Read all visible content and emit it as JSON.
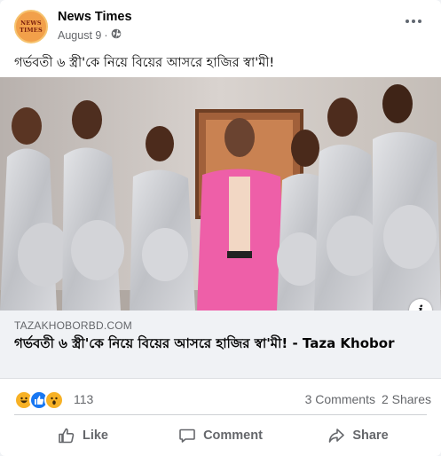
{
  "post": {
    "page_name": "News Times",
    "avatar_text": "NEWS TIMES",
    "date": "August 9",
    "separator": "·",
    "audience_icon": "globe-icon",
    "more_icon": "more-options-icon",
    "text": "গর্ভবতী ৬ স্ত্রী'কে নিয়ে বিয়ের আসরে হাজির স্বা'মী!"
  },
  "link_preview": {
    "domain": "TAZAKHOBORBD.COM",
    "title": "গর্ভবতী ৬ স্ত্রী'কে নিয়ে বিয়ের আসরে হাজির স্বা'মী! - Taza Khobor",
    "info_label": "i"
  },
  "stats": {
    "reaction_icons": [
      "haha-icon",
      "like-icon",
      "wow-icon"
    ],
    "reaction_count": "113",
    "comments": "3 Comments",
    "shares": "2 Shares"
  },
  "actions": {
    "like": "Like",
    "comment": "Comment",
    "share": "Share"
  },
  "colors": {
    "brand_blue": "#1877f2",
    "secondary_text": "#65676b",
    "avatar_orange": "#f2a04a",
    "suit_pink": "#ee5fa8",
    "dress_silver": "#c9cbd0"
  }
}
